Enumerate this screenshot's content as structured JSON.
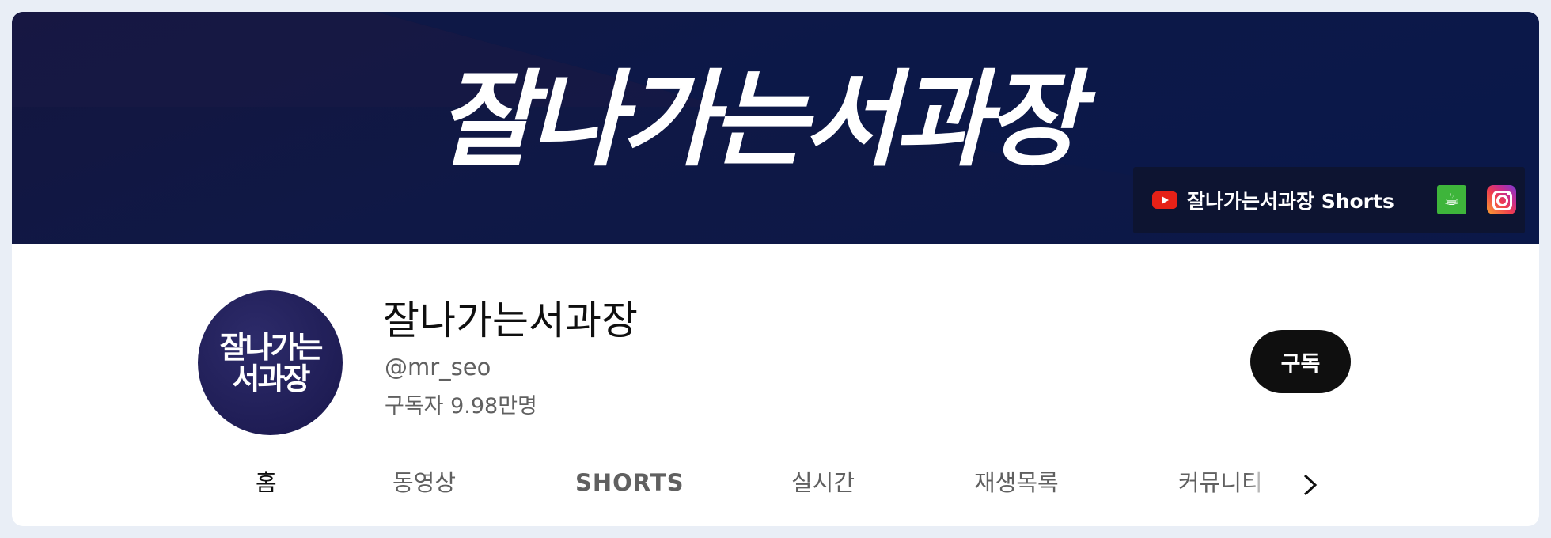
{
  "banner": {
    "title": "잘나가는서과장",
    "links": {
      "shorts_label": "잘나가는서과장 Shorts",
      "icons": [
        "youtube-icon",
        "coffee-cup-icon",
        "instagram-icon"
      ]
    }
  },
  "channel": {
    "avatar_line1": "잘나가는",
    "avatar_line2": "서과장",
    "name": "잘나가는서과장",
    "handle": "@mr_seo",
    "subscribers": "구독자 9.98만명"
  },
  "subscribe_button": "구독",
  "tabs": [
    {
      "label": "홈",
      "active": true
    },
    {
      "label": "동영상",
      "active": false
    },
    {
      "label": "SHORTS",
      "active": false
    },
    {
      "label": "실시간",
      "active": false
    },
    {
      "label": "재생목록",
      "active": false
    },
    {
      "label": "커뮤니티",
      "active": false
    }
  ],
  "colors": {
    "banner": "#0f1846",
    "subscribe": "#0f0f0f",
    "avatar": "#1f1d55"
  }
}
